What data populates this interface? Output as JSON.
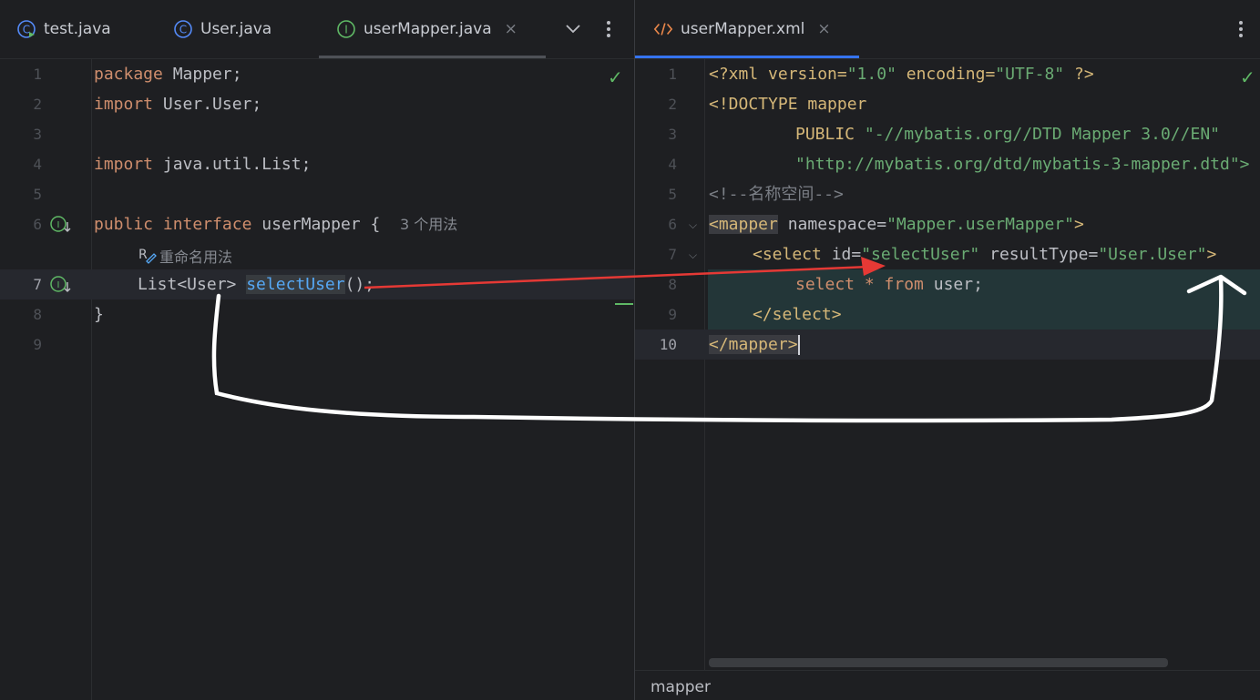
{
  "left_tabs": [
    {
      "label": "test.java",
      "icon": "class-run-icon"
    },
    {
      "label": "User.java",
      "icon": "class-icon"
    },
    {
      "label": "userMapper.java",
      "icon": "interface-icon",
      "active": true
    }
  ],
  "right_tabs": [
    {
      "label": "userMapper.xml",
      "icon": "xml-icon",
      "active": true
    }
  ],
  "tab_close_glyph": "×",
  "left_editor": {
    "line_numbers": [
      "1",
      "2",
      "3",
      "4",
      "5",
      "6",
      "7",
      "8",
      "9"
    ],
    "l1": {
      "kw": "package",
      "rest": " Mapper;"
    },
    "l2": {
      "kw": "import",
      "rest": " User.User;"
    },
    "l4": {
      "kw": "import",
      "rest": " java.util.List;"
    },
    "l6": {
      "kw1": "public",
      "kw2": "interface",
      "rest": " userMapper {",
      "usages": "3 个用法"
    },
    "rename_hint": "重命名用法",
    "l7": {
      "pre": "List<User> ",
      "method": "selectUser",
      "post": "();"
    },
    "l8": {
      "text": "}"
    }
  },
  "right_editor": {
    "line_numbers": [
      "1",
      "2",
      "3",
      "4",
      "5",
      "6",
      "7",
      "8",
      "9",
      "10"
    ],
    "l1": {
      "a": "<?xml version=",
      "b": "\"1.0\"",
      "c": " encoding=",
      "d": "\"UTF-8\"",
      "e": " ?>"
    },
    "l2": {
      "text": "<!DOCTYPE mapper"
    },
    "l3": {
      "kw": "PUBLIC ",
      "str": "\"-//mybatis.org//DTD Mapper 3.0//EN\""
    },
    "l4": {
      "str": "\"http://mybatis.org/dtd/mybatis-3-mapper.dtd\">"
    },
    "l5": {
      "text": "<!--名称空间-->"
    },
    "l6": {
      "tag": "<mapper",
      "attr": " namespace=",
      "val": "\"Mapper.userMapper\"",
      "end": ">"
    },
    "l7": {
      "tag": "<select",
      "attr1": " id=",
      "val1": "\"selectUser\"",
      "attr2": " resultType=",
      "val2": "\"User.User\"",
      "end": ">"
    },
    "l8": {
      "kw1": "select",
      "mid": " * ",
      "kw2": "from",
      "rest": " user;"
    },
    "l9": {
      "tag": "</select>"
    },
    "l10": {
      "tag": "</mapper>"
    }
  },
  "statusbar": {
    "breadcrumb": "mapper"
  },
  "colors": {
    "background": "#1e1f22",
    "keyword": "#cf8e6d",
    "string": "#6aab73",
    "xml_tag": "#d5b778",
    "method": "#56a8f5",
    "active_tab_underline": "#3574f0",
    "arrow_red": "#e53935",
    "annotation_white": "#ffffff"
  }
}
